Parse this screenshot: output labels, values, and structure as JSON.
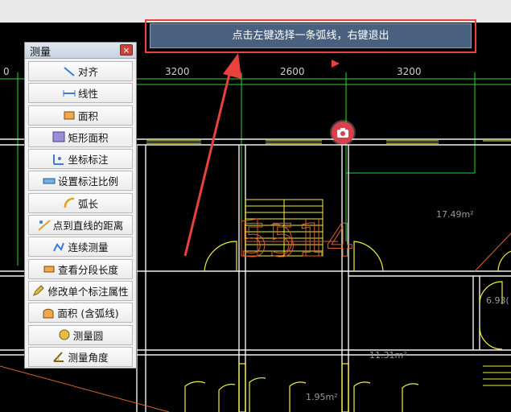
{
  "tooltip": {
    "text": "点击左键选择一条弧线，右键退出"
  },
  "dimensions": [
    "3200",
    "2600",
    "3200"
  ],
  "dim_left_partial": "0",
  "room_labels": {
    "room_a_area": "17.49m²",
    "room_b_area": "11.31m²",
    "room_c_area": "6.93(",
    "room_d_area": "1.95m²",
    "stair_number": "5514"
  },
  "panel": {
    "title": "测量",
    "close": "×",
    "items": [
      {
        "label": "对齐",
        "icon": "align-icon"
      },
      {
        "label": "线性",
        "icon": "linear-icon"
      },
      {
        "label": "面积",
        "icon": "area-icon"
      },
      {
        "label": "矩形面积",
        "icon": "rect-area-icon"
      },
      {
        "label": "坐标标注",
        "icon": "coordinate-icon"
      },
      {
        "label": "设置标注比例",
        "icon": "scale-icon"
      },
      {
        "label": "弧长",
        "icon": "arc-length-icon"
      },
      {
        "label": "点到直线的距离",
        "icon": "point-line-icon"
      },
      {
        "label": "连续测量",
        "icon": "continuous-icon"
      },
      {
        "label": "查看分段长度",
        "icon": "segment-icon"
      },
      {
        "label": "修改单个标注属性",
        "icon": "edit-dim-icon"
      },
      {
        "label": "面积 (含弧线)",
        "icon": "arc-area-icon"
      },
      {
        "label": "测量圆",
        "icon": "circle-icon"
      },
      {
        "label": "测量角度",
        "icon": "angle-icon"
      }
    ]
  },
  "colors": {
    "accent_red": "#e8413e",
    "tooltip_bg": "#4a607f",
    "wall": "#f0f0f0",
    "door": "#f2ee3c",
    "dim_green": "#2fd13a"
  }
}
